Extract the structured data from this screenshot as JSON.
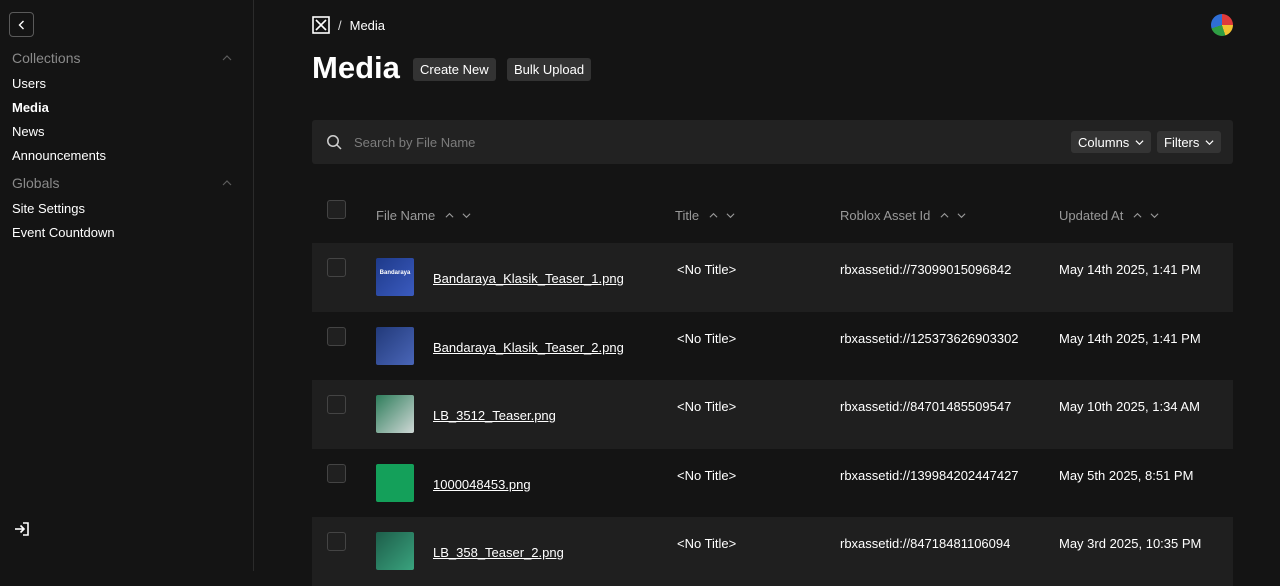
{
  "sidebar": {
    "groups": [
      {
        "label": "Collections",
        "items": [
          "Users",
          "Media",
          "News",
          "Announcements"
        ]
      },
      {
        "label": "Globals",
        "items": [
          "Site Settings",
          "Event Countdown"
        ]
      }
    ],
    "active_item": "Media"
  },
  "breadcrumb": {
    "separator": "/",
    "current": "Media"
  },
  "header": {
    "title": "Media",
    "create_label": "Create New",
    "bulk_label": "Bulk Upload"
  },
  "search": {
    "placeholder": "Search by File Name",
    "columns_label": "Columns",
    "filters_label": "Filters"
  },
  "table": {
    "columns": [
      "File Name",
      "Title",
      "Roblox Asset Id",
      "Updated At"
    ],
    "rows": [
      {
        "file": "Bandaraya_Klasik_Teaser_1.png",
        "title": "<No Title>",
        "asset": "rbxassetid://73099015096842",
        "updated": "May 14th 2025, 1:41 PM",
        "thumb_color": "#1e3a8a",
        "thumb_text": "Bandaraya"
      },
      {
        "file": "Bandaraya_Klasik_Teaser_2.png",
        "title": "<No Title>",
        "asset": "rbxassetid://125373626903302",
        "updated": "May 14th 2025, 1:41 PM",
        "thumb_color": "#223a7a",
        "thumb_text": ""
      },
      {
        "file": "LB_3512_Teaser.png",
        "title": "<No Title>",
        "asset": "rbxassetid://84701485509547",
        "updated": "May 10th 2025, 1:34 AM",
        "thumb_color": "#3f6f5a",
        "thumb_text": ""
      },
      {
        "file": "1000048453.png",
        "title": "<No Title>",
        "asset": "rbxassetid://139984202447427",
        "updated": "May 5th 2025, 8:51 PM",
        "thumb_color": "#14a05a",
        "thumb_text": ""
      },
      {
        "file": "LB_358_Teaser_2.png",
        "title": "<No Title>",
        "asset": "rbxassetid://84718481106094",
        "updated": "May 3rd 2025, 10:35 PM",
        "thumb_color": "#1d5e4a",
        "thumb_text": ""
      }
    ]
  },
  "colors": {
    "background": "#141414",
    "row_alt": "#1f1f1f",
    "button": "#333333"
  }
}
